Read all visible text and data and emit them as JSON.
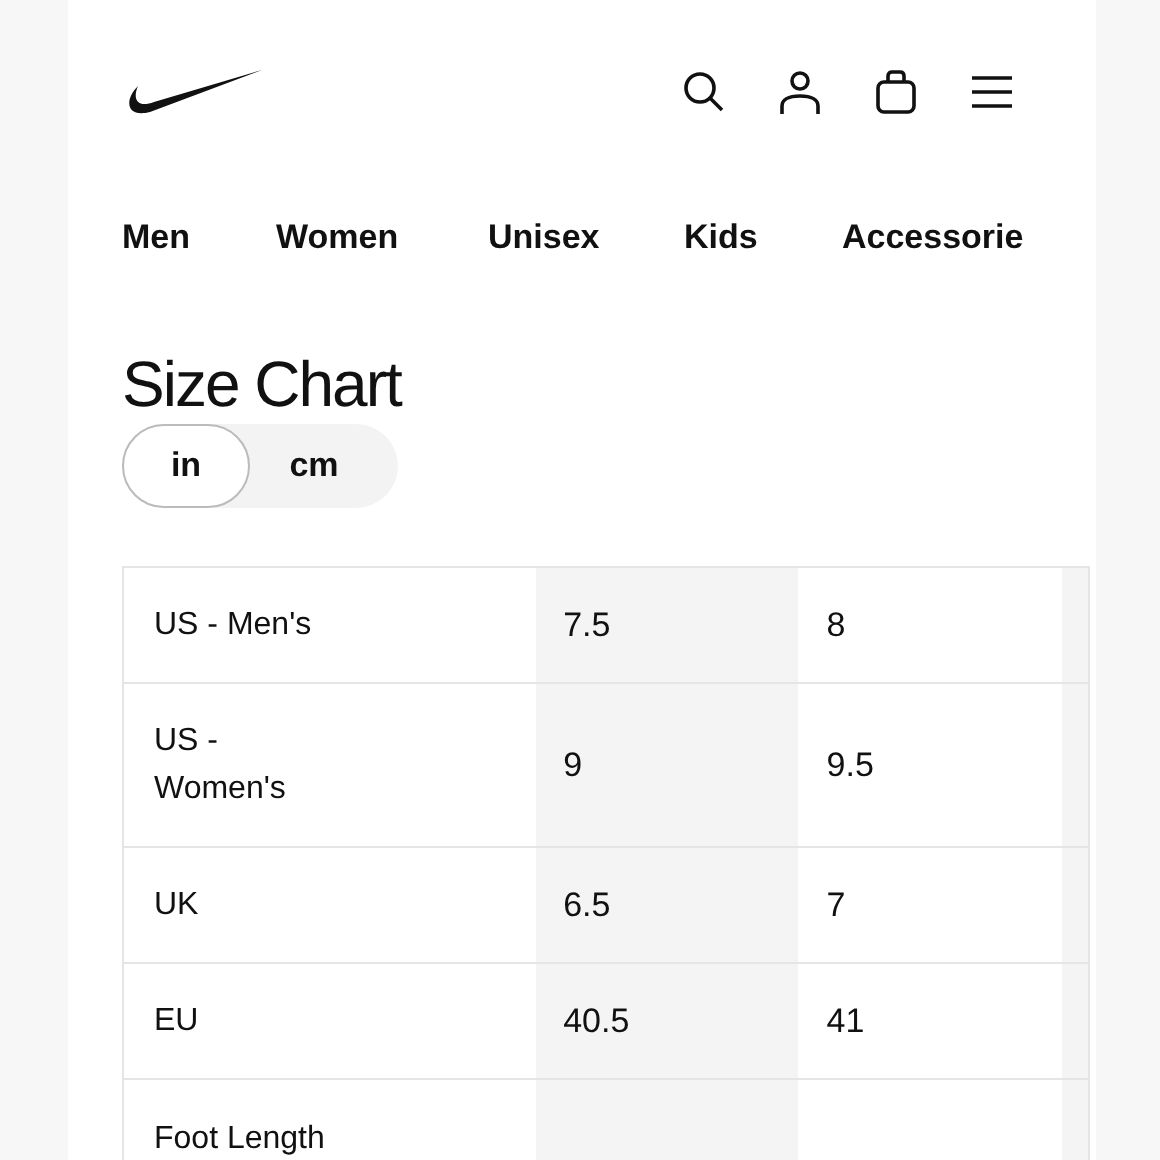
{
  "nav": [
    {
      "label": "Men"
    },
    {
      "label": "Women"
    },
    {
      "label": "Unisex"
    },
    {
      "label": "Kids"
    },
    {
      "label": "Accessorie"
    }
  ],
  "title": "Size Chart",
  "units": [
    {
      "label": "in",
      "selected": true
    },
    {
      "label": "cm",
      "selected": false
    }
  ],
  "rows": [
    {
      "label": "US - Men's",
      "values": [
        "7.5",
        "8"
      ]
    },
    {
      "label": "US - Women's",
      "values": [
        "9",
        "9.5"
      ]
    },
    {
      "label": "UK",
      "values": [
        "6.5",
        "7"
      ]
    },
    {
      "label": "EU",
      "values": [
        "40.5",
        "41"
      ]
    },
    {
      "label": "Foot Length",
      "values": []
    }
  ]
}
